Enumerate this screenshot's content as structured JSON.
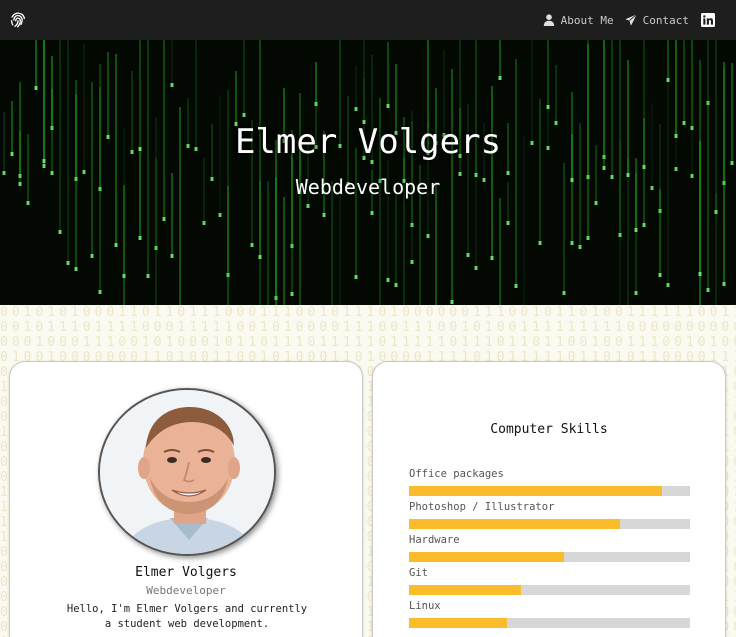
{
  "nav": {
    "logo_icon": "fingerprint-icon",
    "links": [
      {
        "label": "About Me",
        "icon": "person-icon"
      },
      {
        "label": "Contact",
        "icon": "paper-plane-icon"
      }
    ],
    "linkedin_icon": "linkedin-icon"
  },
  "hero": {
    "title": "Elmer Volgers",
    "subtitle": "Webdeveloper"
  },
  "profile": {
    "name": "Elmer Volgers",
    "role": "Webdeveloper",
    "bio": "Hello, I'm Elmer Volgers and currently a student web development."
  },
  "skills": {
    "title": "Computer Skills",
    "items": [
      {
        "label": "Office packages",
        "level": 0.9
      },
      {
        "label": "Photoshop / Illustrator",
        "level": 0.75
      },
      {
        "label": "Hardware",
        "level": 0.55
      },
      {
        "label": "Git",
        "level": 0.4
      },
      {
        "label": "Linux",
        "level": 0.35
      }
    ]
  },
  "colors": {
    "accent": "#fbbc2c",
    "nav_bg": "#1e1e1e",
    "matrix_green": "#1fd11f"
  }
}
